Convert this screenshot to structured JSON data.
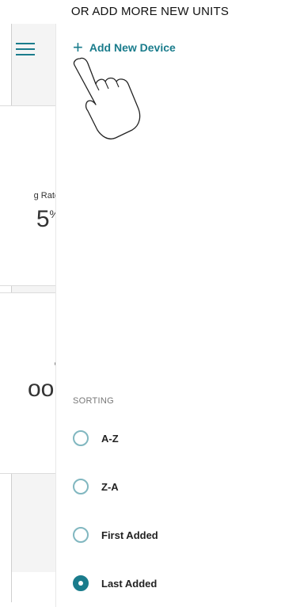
{
  "caption": "OR ADD MORE NEW UNITS",
  "background_cards": [
    {
      "label": "g Rate",
      "value": "5",
      "unit": "%"
    },
    {
      "label": "e",
      "value": "ool"
    }
  ],
  "drawer": {
    "add_device_label": "Add New Device",
    "sort_heading": "SORTING",
    "options": [
      {
        "label": "A-Z",
        "selected": false
      },
      {
        "label": "Z-A",
        "selected": false
      },
      {
        "label": "First Added",
        "selected": false
      },
      {
        "label": "Last Added",
        "selected": true
      }
    ]
  },
  "colors": {
    "accent": "#1a7c8c"
  },
  "icons": {
    "menu": "hamburger-icon",
    "add": "plus-icon",
    "hint": "pointing-hand-icon"
  }
}
